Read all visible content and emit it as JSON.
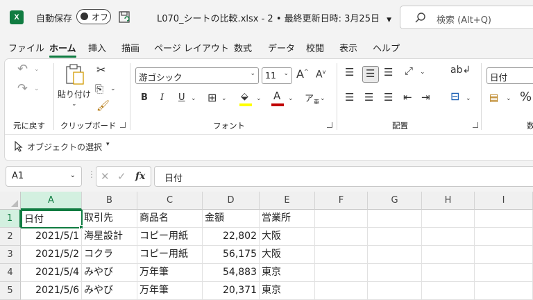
{
  "titlebar": {
    "autosave_label": "自動保存",
    "toggle_state": "オフ",
    "file_name": "L070_シートの比較.xlsx",
    "save_info": "- 2 • 最終更新日時: 3月25日",
    "search_placeholder": "検索 (Alt+Q)"
  },
  "tabs": [
    "ファイル",
    "ホーム",
    "挿入",
    "描画",
    "ページ レイアウト",
    "数式",
    "データ",
    "校閲",
    "表示",
    "ヘルプ"
  ],
  "active_tab": "ホーム",
  "ribbon": {
    "undo_group_label": "元に戻す",
    "paste_label": "貼り付け",
    "clipboard_label": "クリップボード",
    "font_name": "游ゴシック",
    "font_size": "11",
    "font_label": "フォント",
    "alignment_label": "配置",
    "number_format": "日付",
    "number_label": "数",
    "bold": "B",
    "italic": "I",
    "underline": "U",
    "select_objects_label": "オブジェクトの選択"
  },
  "formula_bar": {
    "name_box": "A1",
    "formula": "日付"
  },
  "sheet": {
    "columns": [
      "A",
      "B",
      "C",
      "D",
      "E",
      "F",
      "G",
      "H",
      "I"
    ],
    "rows": [
      "1",
      "2",
      "3",
      "4",
      "5"
    ],
    "cells": [
      [
        "日付",
        "取引先",
        "商品名",
        "金額",
        "営業所"
      ],
      [
        "2021/5/1",
        "海星設計",
        "コピー用紙",
        "22,802",
        "大阪"
      ],
      [
        "2021/5/2",
        "コクラ",
        "コピー用紙",
        "56,175",
        "大阪"
      ],
      [
        "2021/5/4",
        "みやび",
        "万年筆",
        "54,883",
        "東京"
      ],
      [
        "2021/5/6",
        "みやび",
        "万年筆",
        "20,371",
        "東京"
      ]
    ]
  },
  "colors": {
    "accent": "#107c41",
    "font_color": "#c00000",
    "highlight_color": "#ffff00"
  }
}
